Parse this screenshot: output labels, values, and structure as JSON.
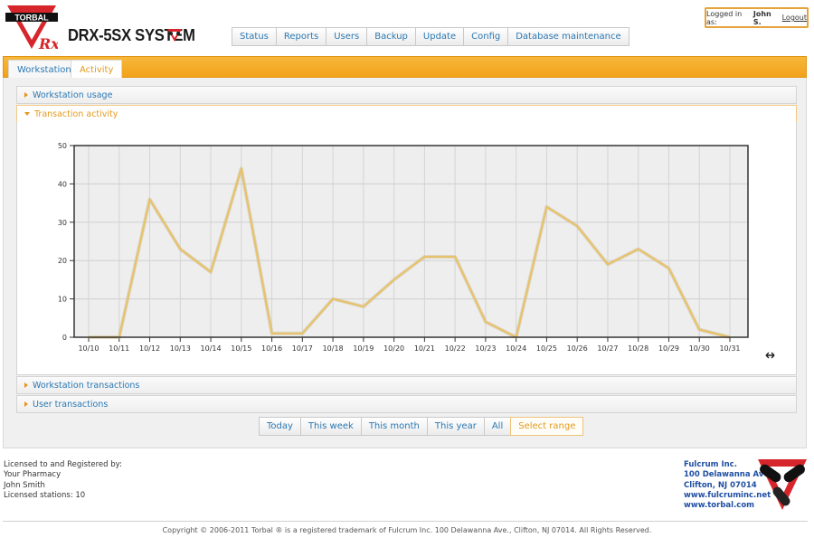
{
  "header": {
    "brand": "TORBAL",
    "title": "DRX-5SX SYSTEM",
    "nav": [
      "Status",
      "Reports",
      "Users",
      "Backup",
      "Update",
      "Config",
      "Database maintenance"
    ],
    "login": {
      "prefix": "Logged in as:",
      "user": "John S.",
      "logout": "Logout"
    }
  },
  "tabs": [
    "Workstation",
    "Activity"
  ],
  "active_tab": "Activity",
  "accordion": {
    "workstation_usage": "Workstation usage",
    "transaction_activity": "Transaction activity",
    "workstation_transactions": "Workstation transactions",
    "user_transactions": "User transactions"
  },
  "range_buttons": [
    "Today",
    "This week",
    "This month",
    "This year",
    "All",
    "Select range"
  ],
  "active_range": "Select range",
  "chart_data": {
    "type": "line",
    "categories": [
      "10/10",
      "10/11",
      "10/12",
      "10/13",
      "10/14",
      "10/15",
      "10/16",
      "10/17",
      "10/18",
      "10/19",
      "10/20",
      "10/21",
      "10/22",
      "10/23",
      "10/24",
      "10/25",
      "10/26",
      "10/27",
      "10/28",
      "10/29",
      "10/30",
      "10/31"
    ],
    "values": [
      0,
      0,
      36,
      23,
      17,
      44,
      1,
      1,
      10,
      8,
      15,
      21,
      21,
      4,
      0,
      34,
      29,
      19,
      23,
      18,
      2,
      0
    ],
    "ylim": [
      0,
      50
    ],
    "yticks": [
      0,
      10,
      20,
      30,
      40,
      50
    ],
    "grid": true,
    "line_color": "#e8c26a"
  },
  "footer": {
    "license": [
      "Licensed to and Registered by:",
      "Your Pharmacy",
      "John Smith",
      "Licensed stations: 10"
    ],
    "company": [
      "Fulcrum Inc.",
      "100 Delawanna Ave.",
      "Clifton, NJ 07014",
      "www.fulcruminc.net",
      "www.torbal.com"
    ],
    "copyright": "Copyright © 2006-2011 Torbal ® is a registered trademark of Fulcrum Inc. 100 Delawanna Ave., Clifton, NJ 07014. All Rights Reserved."
  }
}
